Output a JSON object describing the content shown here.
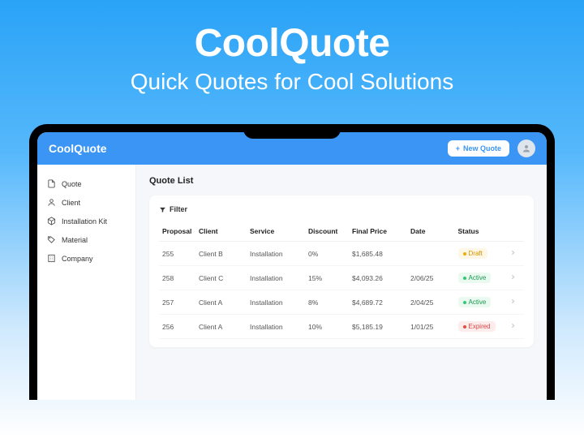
{
  "hero": {
    "title": "CoolQuote",
    "subtitle": "Quick Quotes for Cool Solutions"
  },
  "topbar": {
    "brand": "CoolQuote",
    "new_quote": "New Quote"
  },
  "sidebar": {
    "items": [
      {
        "label": "Quote",
        "icon": "file-icon"
      },
      {
        "label": "Client",
        "icon": "user-icon"
      },
      {
        "label": "Installation Kit",
        "icon": "package-icon"
      },
      {
        "label": "Material",
        "icon": "tag-icon"
      },
      {
        "label": "Company",
        "icon": "building-icon"
      }
    ]
  },
  "main": {
    "heading": "Quote List",
    "filter_label": "Filter",
    "columns": [
      "Proposal",
      "Client",
      "Service",
      "Discount",
      "Final Price",
      "Date",
      "Status"
    ],
    "rows": [
      {
        "proposal": "255",
        "client": "Client B",
        "service": "Installation",
        "discount": "0%",
        "price": "$1,685.48",
        "date": "",
        "status": "Draft",
        "status_class": "draft"
      },
      {
        "proposal": "258",
        "client": "Client C",
        "service": "Installation",
        "discount": "15%",
        "price": "$4,093.26",
        "date": "2/06/25",
        "status": "Active",
        "status_class": "active"
      },
      {
        "proposal": "257",
        "client": "Client A",
        "service": "Installation",
        "discount": "8%",
        "price": "$4,689.72",
        "date": "2/04/25",
        "status": "Active",
        "status_class": "active"
      },
      {
        "proposal": "256",
        "client": "Client A",
        "service": "Installation",
        "discount": "10%",
        "price": "$5,185.19",
        "date": "1/01/25",
        "status": "Expired",
        "status_class": "expired"
      }
    ]
  }
}
